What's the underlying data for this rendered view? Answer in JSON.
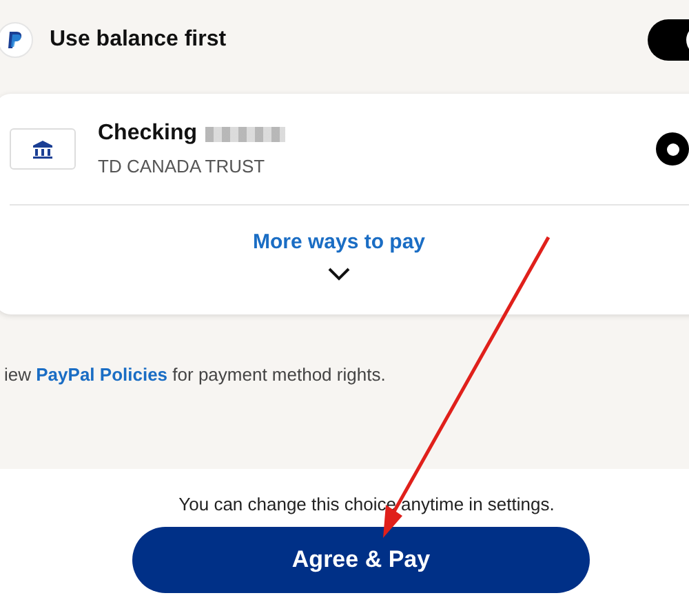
{
  "balance_row": {
    "label": "Use balance first",
    "on": true
  },
  "payment_method": {
    "name": "Checking",
    "bank": "TD CANADA TRUST",
    "selected": true
  },
  "more_ways": {
    "label": "More ways to pay"
  },
  "policy_note": {
    "before": "iew",
    "link": "PayPal Policies",
    "after": "for payment method rights."
  },
  "footer": {
    "note": "You can change this choice anytime in settings.",
    "button": "Agree & Pay"
  }
}
